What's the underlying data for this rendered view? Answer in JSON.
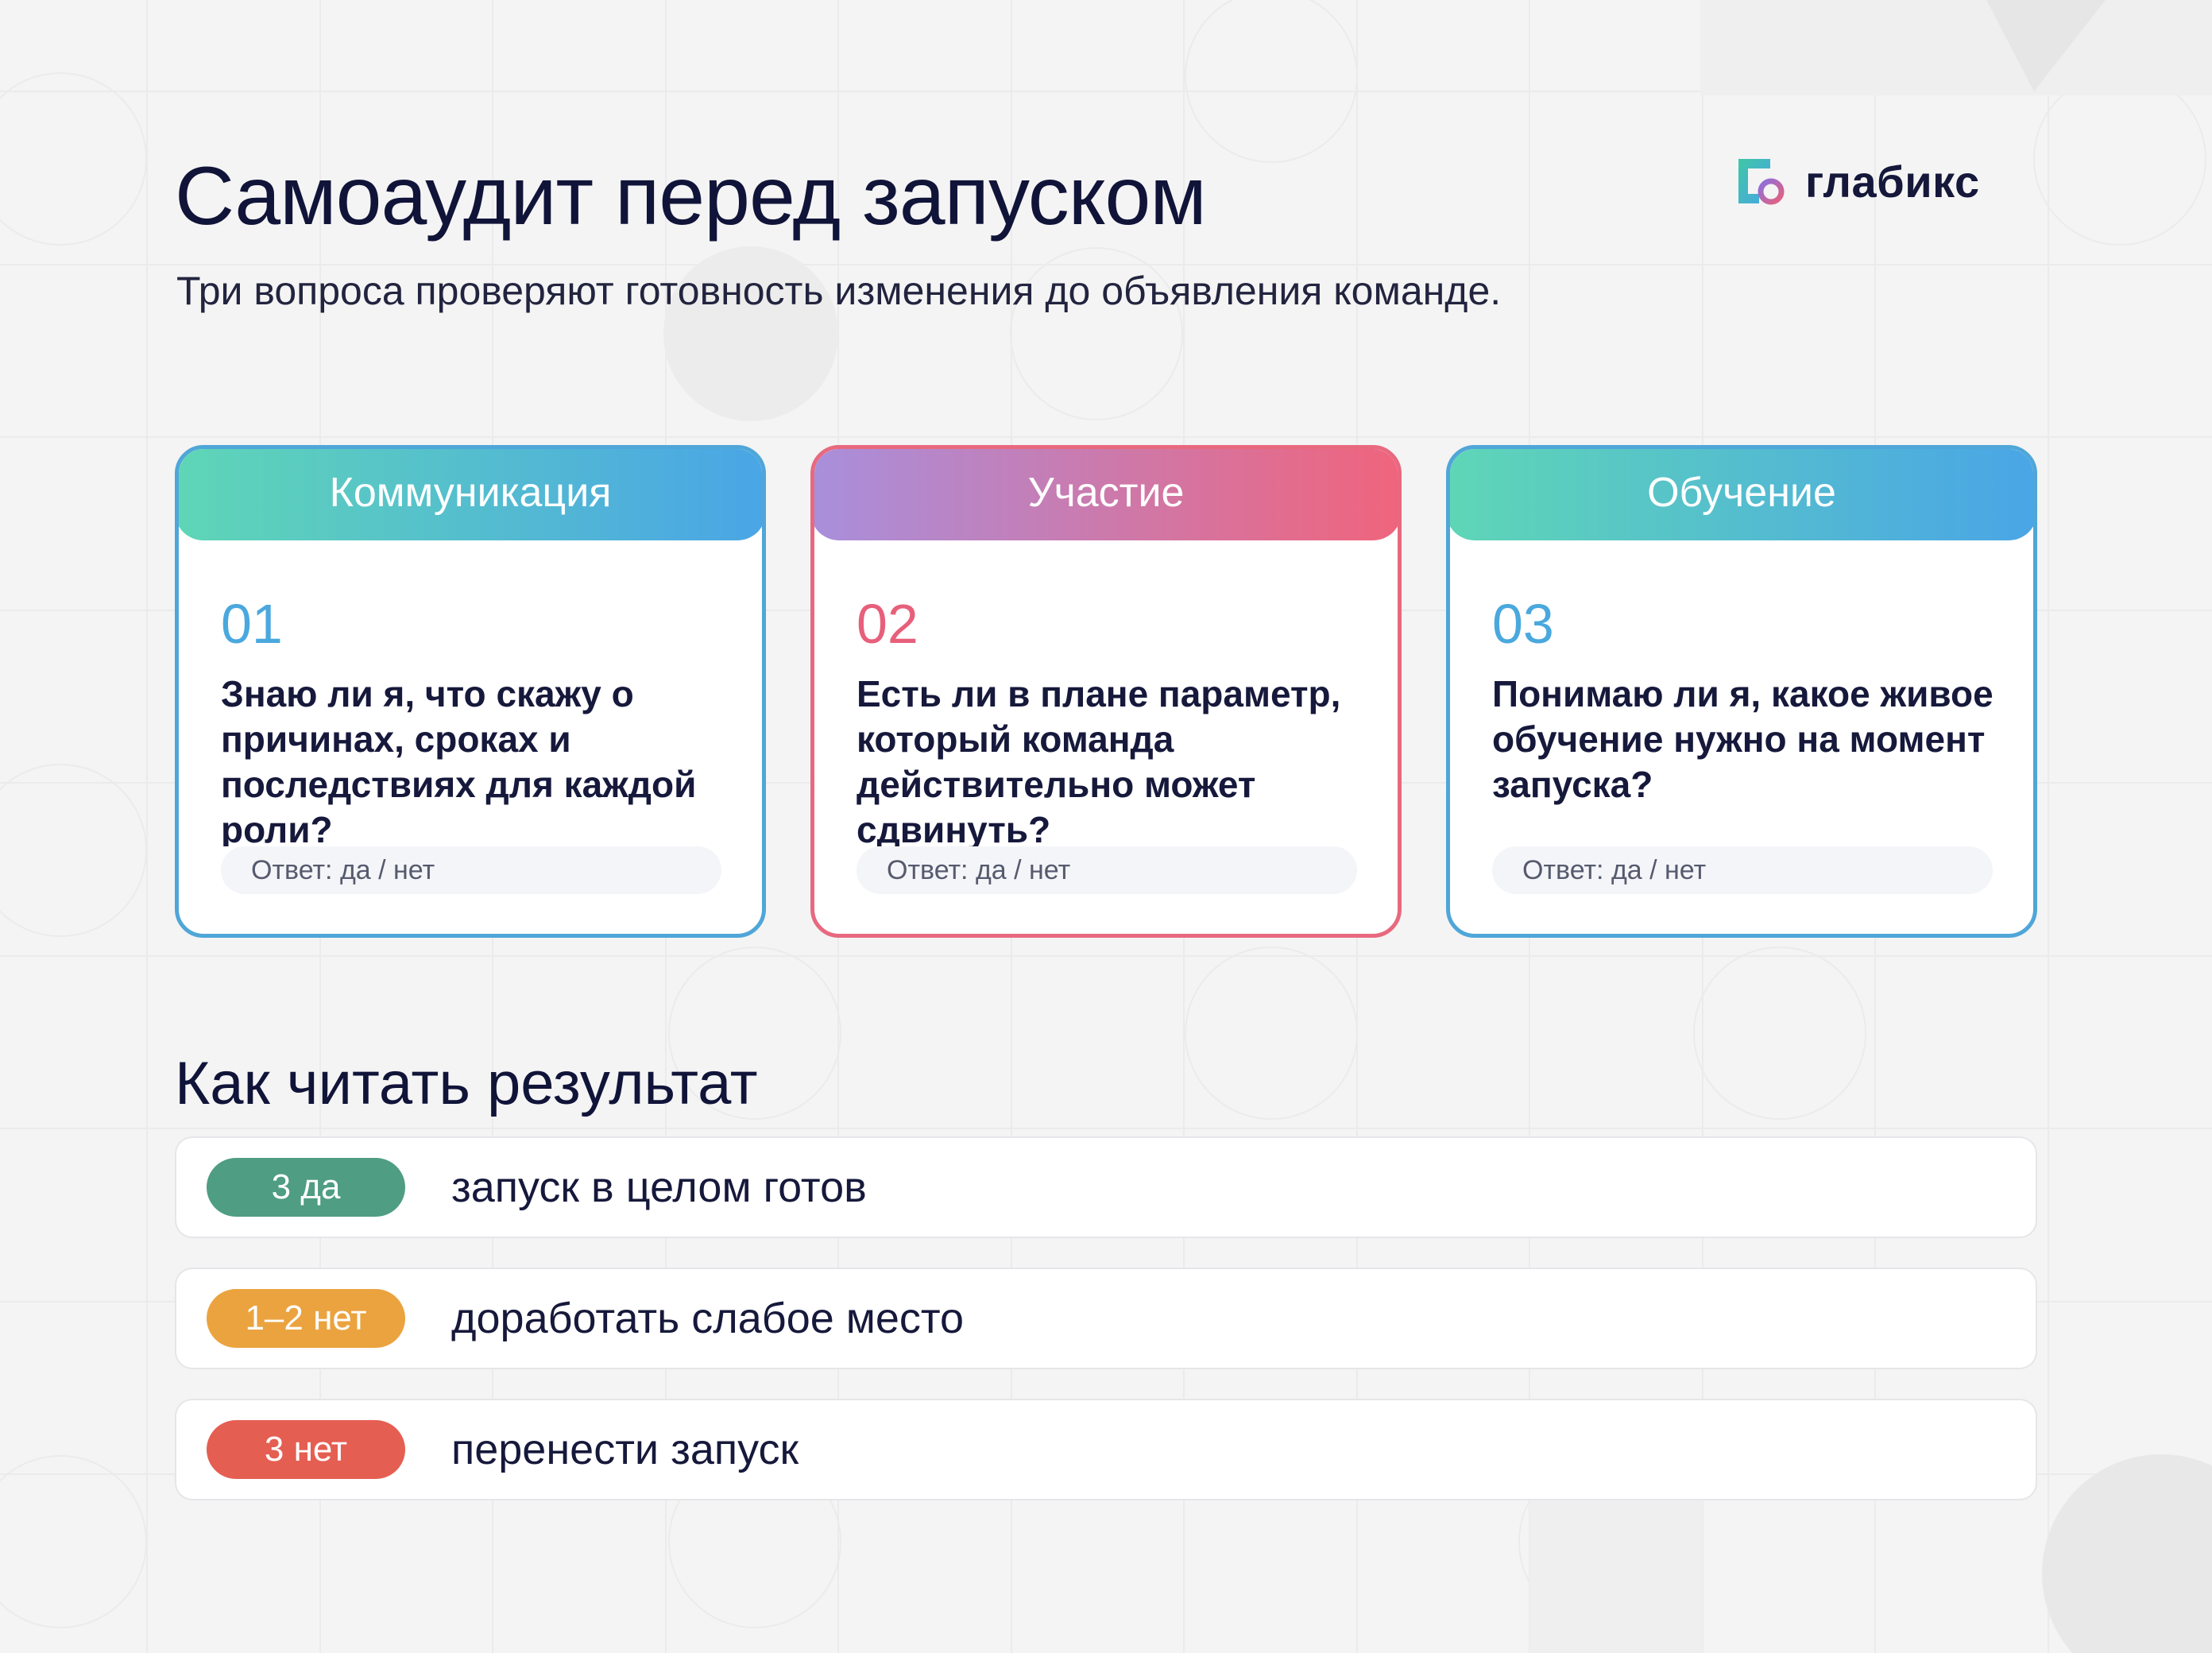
{
  "header": {
    "title": "Самоаудит перед запуском",
    "subtitle": "Три вопроса проверяют готовность изменения до объявления команде."
  },
  "logo": {
    "text": "глабикс",
    "icon": "glabiks-logo-mark",
    "colors": [
      "#3fc7a5",
      "#4aa5e6",
      "#e7607b"
    ]
  },
  "cards": [
    {
      "category": "Коммуникация",
      "number": "01",
      "question": "Знаю ли я, что скажу о причинах, сроках и последствиях для каждой роли?",
      "answer": "Ответ: да / нет",
      "accent": "#4fa6d8"
    },
    {
      "category": "Участие",
      "number": "02",
      "question": "Есть ли в плане параметр, который команда действительно может сдвинуть?",
      "answer": "Ответ: да / нет",
      "accent": "#e8697f"
    },
    {
      "category": "Обучение",
      "number": "03",
      "question": "Понимаю ли я, какое живое обучение нужно на момент запуска?",
      "answer": "Ответ: да / нет",
      "accent": "#4fa6d8"
    }
  ],
  "results": {
    "title": "Как читать результат",
    "rows": [
      {
        "badge": "3 да",
        "text": "запуск в целом готов",
        "color": "#4f9d83"
      },
      {
        "badge": "1–2 нет",
        "text": "доработать слабое место",
        "color": "#eba33f"
      },
      {
        "badge": "3 нет",
        "text": "перенести запуск",
        "color": "#e55e52"
      }
    ]
  }
}
